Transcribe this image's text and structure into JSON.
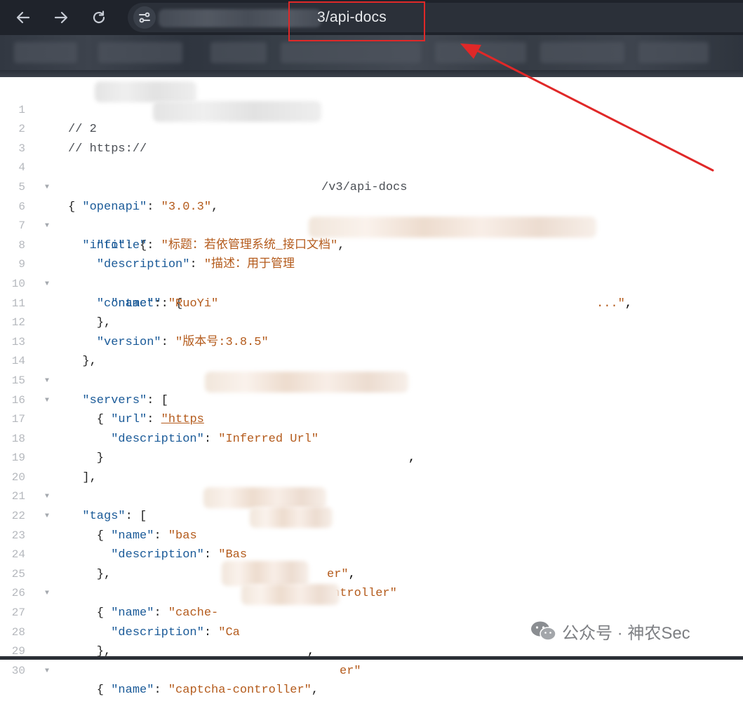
{
  "browser": {
    "url_visible_fragment": "3/api-docs"
  },
  "code": {
    "lines": [
      {
        "n": "1",
        "fold": ""
      },
      {
        "n": "2",
        "fold": ""
      },
      {
        "n": "3",
        "fold": ""
      },
      {
        "n": "4",
        "fold": "▼"
      },
      {
        "n": "5",
        "fold": ""
      },
      {
        "n": "6",
        "fold": "▼"
      },
      {
        "n": "7",
        "fold": ""
      },
      {
        "n": "8",
        "fold": ""
      },
      {
        "n": "9",
        "fold": "▼"
      },
      {
        "n": "10",
        "fold": ""
      },
      {
        "n": "11",
        "fold": ""
      },
      {
        "n": "12",
        "fold": ""
      },
      {
        "n": "13",
        "fold": ""
      },
      {
        "n": "14",
        "fold": "▼"
      },
      {
        "n": "15",
        "fold": "▼"
      },
      {
        "n": "16",
        "fold": ""
      },
      {
        "n": "17",
        "fold": ""
      },
      {
        "n": "18",
        "fold": ""
      },
      {
        "n": "19",
        "fold": ""
      },
      {
        "n": "20",
        "fold": "▼"
      },
      {
        "n": "21",
        "fold": "▼"
      },
      {
        "n": "22",
        "fold": ""
      },
      {
        "n": "23",
        "fold": ""
      },
      {
        "n": "24",
        "fold": ""
      },
      {
        "n": "25",
        "fold": "▼"
      },
      {
        "n": "26",
        "fold": ""
      },
      {
        "n": "27",
        "fold": ""
      },
      {
        "n": "28",
        "fold": ""
      },
      {
        "n": "29",
        "fold": "▼"
      },
      {
        "n": "30",
        "fold": ""
      }
    ],
    "comment_1": "// 2",
    "comment_2_prefix": "// https://",
    "comment_2_suffix": "/v3/api-docs",
    "brace_open": "{",
    "key_openapi": "\"openapi\"",
    "val_openapi": "\"3.0.3\"",
    "key_info": "\"info\"",
    "key_title": "\"title\"",
    "val_title": "\"标题：若依管理系统_接口文档\"",
    "key_description": "\"description\"",
    "val_description_start": "\"描述：用于管理",
    "val_description_end": "...\"",
    "key_contact": "\"contact\"",
    "key_name": "\"name\"",
    "val_contact_name": "\"RuoYi\"",
    "key_version": "\"version\"",
    "val_version": "\"版本号:3.8.5\"",
    "key_servers": "\"servers\"",
    "key_url": "\"url\"",
    "val_url_start": "\"https",
    "val_server_description": "\"Inferred Url\"",
    "key_tags": "\"tags\"",
    "tag1_name_start": "\"bas",
    "tag1_name_end": "er\"",
    "tag1_desc_start": "\"Bas",
    "tag1_desc_end": "ntroller\"",
    "tag2_name_start": "\"cache-",
    "tag2_desc_start": "\"Ca",
    "tag2_desc_end": "er\"",
    "tag3_name": "\"captcha-controller\""
  },
  "watermark": {
    "text": "公众号 · 神农Sec"
  },
  "colors": {
    "annotation_red": "#e02828",
    "json_key": "#1a5a98",
    "json_string": "#b45b1c"
  }
}
